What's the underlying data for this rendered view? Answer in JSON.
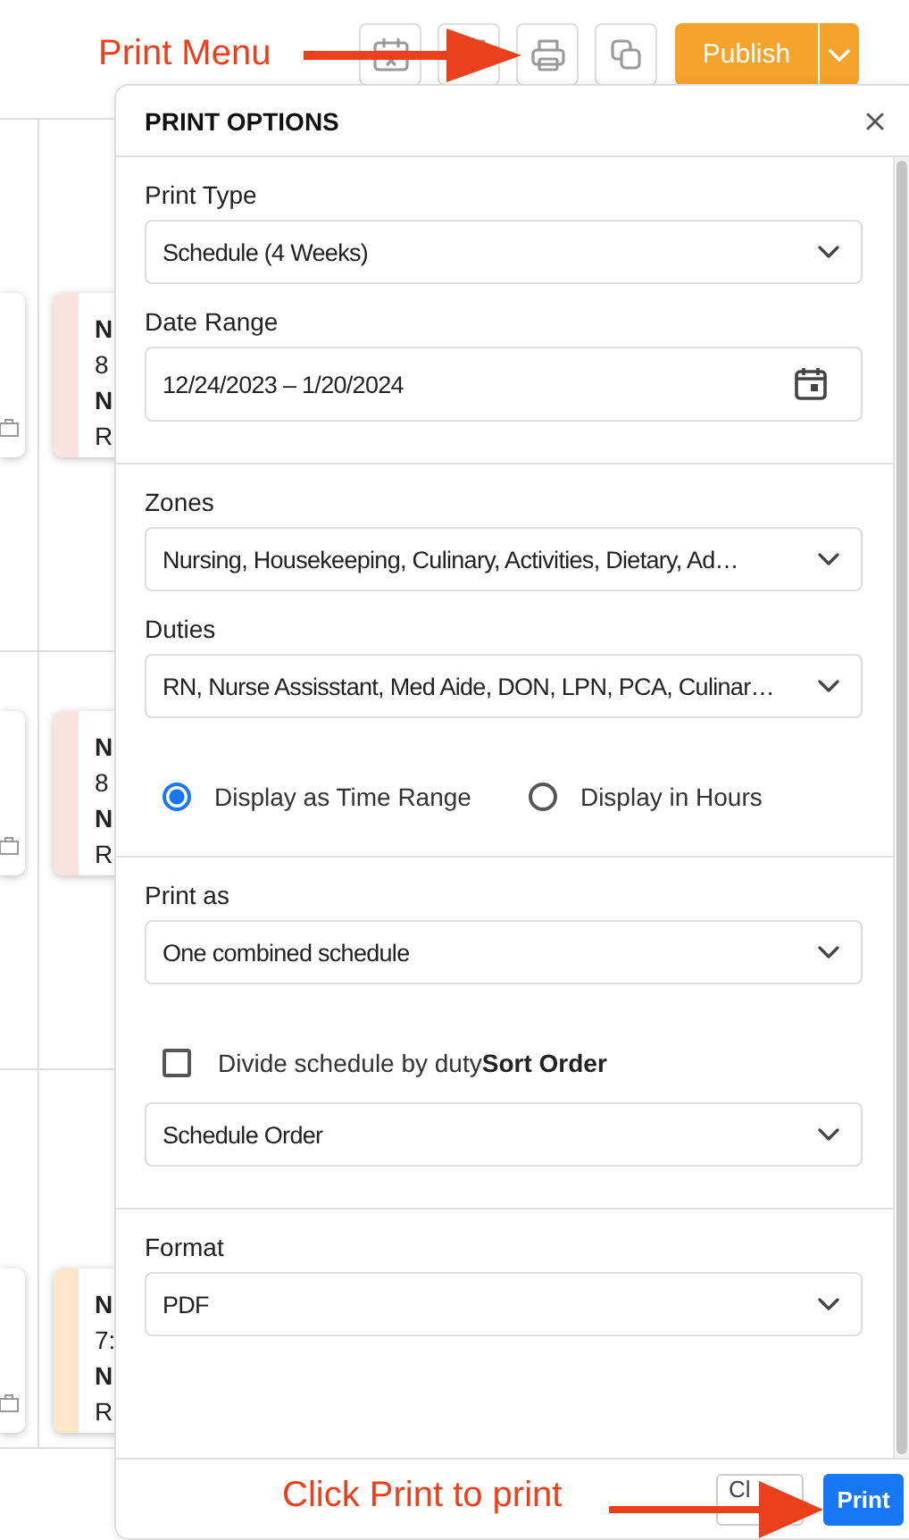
{
  "toolbar": {
    "publish_button": "Publish"
  },
  "schedule": {
    "cards": [
      {
        "color": "#f9e3df",
        "lines": [
          "N",
          "8",
          "N",
          "R"
        ]
      },
      {
        "color": "#f9e3df",
        "lines": [
          "N",
          "8",
          "N",
          "R"
        ]
      },
      {
        "color": "#fde6cb",
        "lines": [
          "N",
          "7:",
          "N",
          "R"
        ]
      }
    ]
  },
  "print_options": {
    "title": "PRINT OPTIONS",
    "sections": [
      {
        "fields": [
          {
            "kind": "select",
            "label": "Print Type",
            "value": "Schedule (4 Weeks)"
          },
          {
            "kind": "date",
            "label": "Date Range",
            "value": "12/24/2023 – 1/20/2024"
          }
        ]
      },
      {
        "fields": [
          {
            "kind": "select",
            "label": "Zones",
            "value": "Nursing, Housekeeping, Culinary, Activities, Dietary, Ad…"
          },
          {
            "kind": "select",
            "label": "Duties",
            "value": "RN, Nurse Assisstant, Med Aide, DON, LPN, PCA, Culinar…"
          },
          {
            "kind": "radios",
            "options": [
              {
                "label": "Display as Time Range",
                "selected": true
              },
              {
                "label": "Display in Hours",
                "selected": false
              }
            ]
          }
        ]
      },
      {
        "fields": [
          {
            "kind": "select",
            "label": "Print as",
            "value": "One combined schedule"
          },
          {
            "kind": "checkbox",
            "label": "Divide schedule by duty",
            "checked": false,
            "trailing_label": "Sort Order"
          },
          {
            "kind": "select",
            "value": "Schedule Order"
          }
        ]
      },
      {
        "fields": [
          {
            "kind": "select",
            "label": "Format",
            "value": "PDF"
          }
        ]
      }
    ],
    "footer_buttons": [
      {
        "kind": "secondary",
        "label": "Cl"
      },
      {
        "kind": "primary",
        "label": "Print"
      }
    ]
  },
  "annotations": [
    {
      "text": "Print Menu"
    },
    {
      "text": "Click Print to print"
    }
  ]
}
